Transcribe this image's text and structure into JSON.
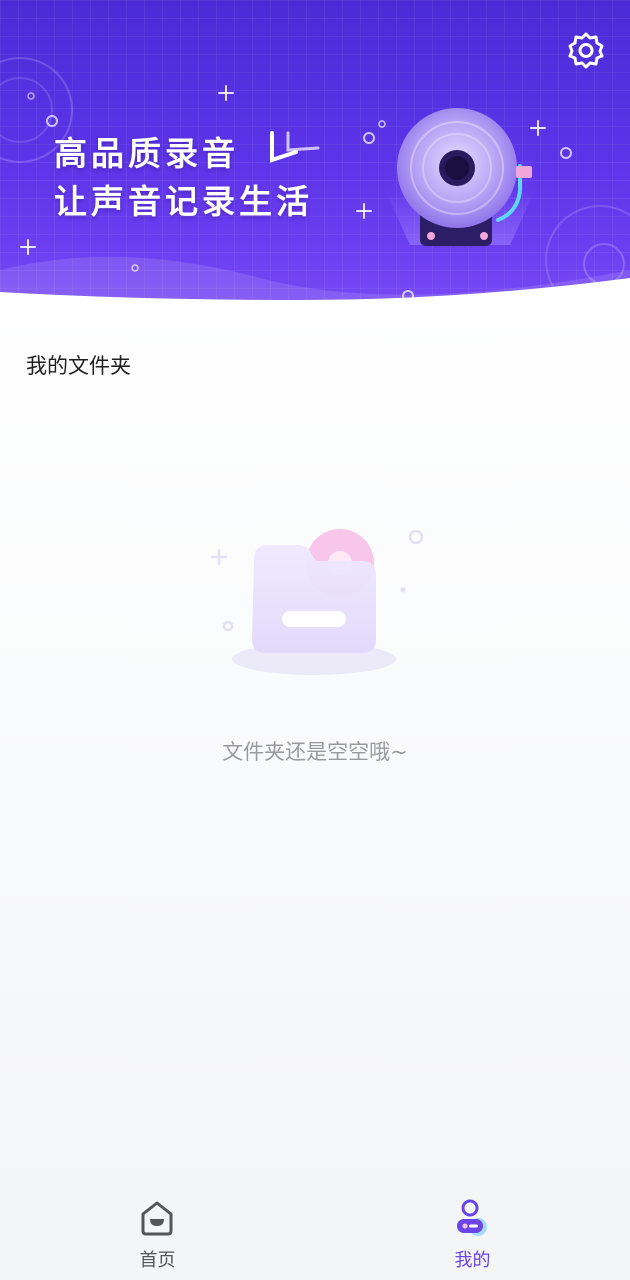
{
  "banner": {
    "line1": "高品质录音",
    "line2": "让声音记录生活",
    "settings_icon": "gear-icon"
  },
  "folder": {
    "title": "我的文件夹",
    "empty_message": "文件夹还是空空哦~",
    "empty_icon": "empty-folder-icon"
  },
  "bottom_nav": {
    "items": [
      {
        "label": "首页",
        "icon": "home-icon",
        "active": false
      },
      {
        "label": "我的",
        "icon": "profile-icon",
        "active": true
      }
    ],
    "active_color": "#6b45e6",
    "inactive_color": "#555555"
  },
  "colors": {
    "banner_start": "#4b2bd6",
    "banner_end": "#7a4cf5"
  }
}
